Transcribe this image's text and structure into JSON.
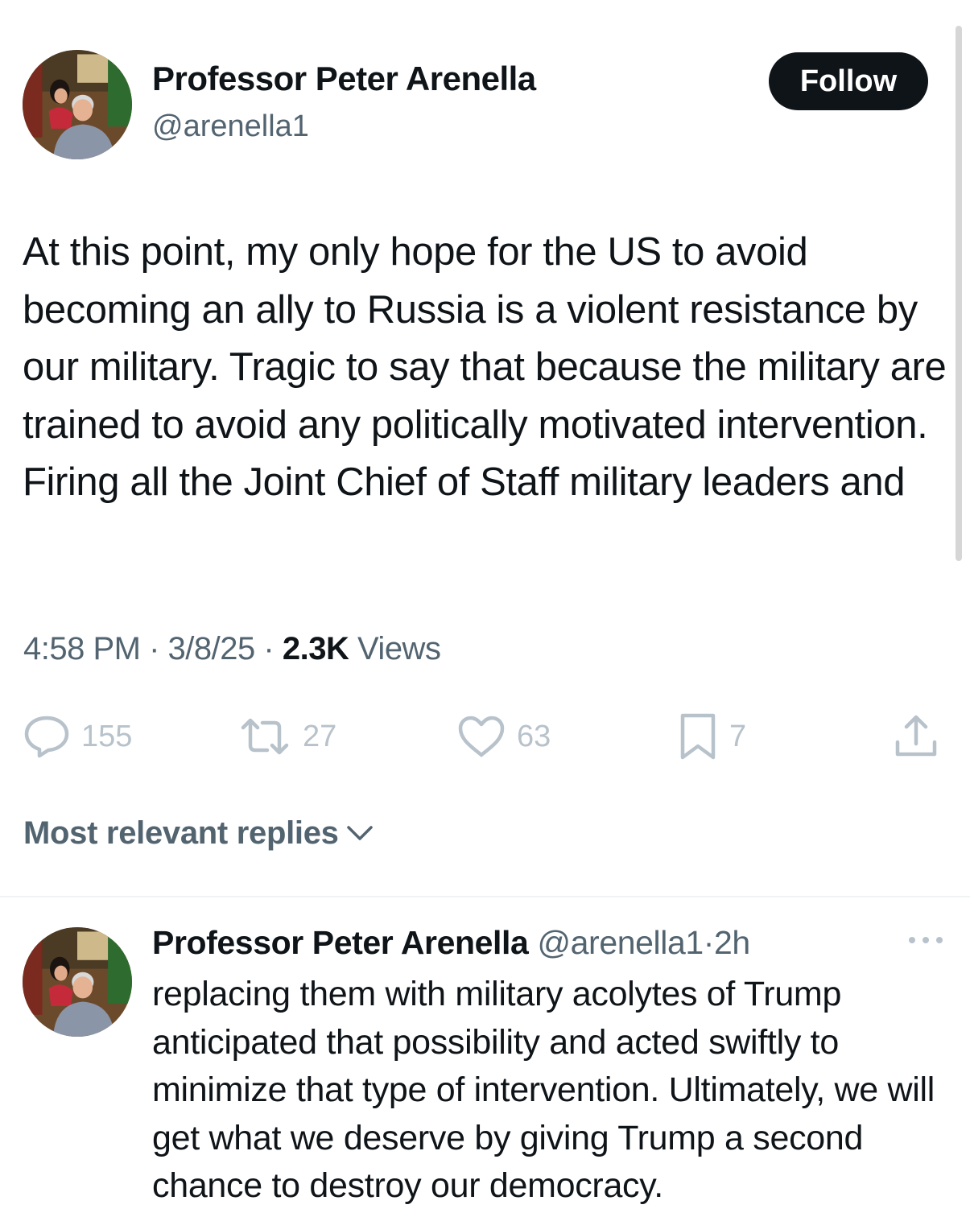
{
  "tweet": {
    "author_name": "Professor Peter Arenella",
    "author_handle": "@arenella1",
    "follow_label": "Follow",
    "text": "At this point, my only hope for the US to avoid becoming an ally to Russia is a violent resistance by our military. Tragic to say that because the military are trained to avoid any politically motivated  intervention. Firing all the Joint Chief of Staff military leaders and",
    "time": "4:58 PM",
    "date": "3/8/25",
    "separator": "·",
    "views_count": "2.3K",
    "views_label": "Views",
    "actions": {
      "replies": {
        "count": "155",
        "icon": "reply-icon"
      },
      "reposts": {
        "count": "27",
        "icon": "repost-icon"
      },
      "likes": {
        "count": "63",
        "icon": "heart-icon"
      },
      "bookmarks": {
        "count": "7",
        "icon": "bookmark-icon"
      },
      "share": {
        "icon": "share-icon"
      }
    }
  },
  "replies_section": {
    "sort_label": "Most relevant replies",
    "sort_icon": "chevron-down-icon"
  },
  "reply": {
    "author_name": "Professor Peter Arenella",
    "author_handle": "@arenella1",
    "separator": "·",
    "time": "2h",
    "more_icon": "more-icon",
    "text": "replacing them with military acolytes of Trump anticipated that possibility and acted swiftly to minimize that type of intervention. Ultimately, we will get what we deserve by giving Trump a second chance to destroy our democracy."
  },
  "colors": {
    "text_primary": "#0f1419",
    "text_secondary": "#536471",
    "action_icons": "#b8c2cb",
    "follow_button_bg": "#0f1419",
    "divider": "#eff3f4"
  }
}
